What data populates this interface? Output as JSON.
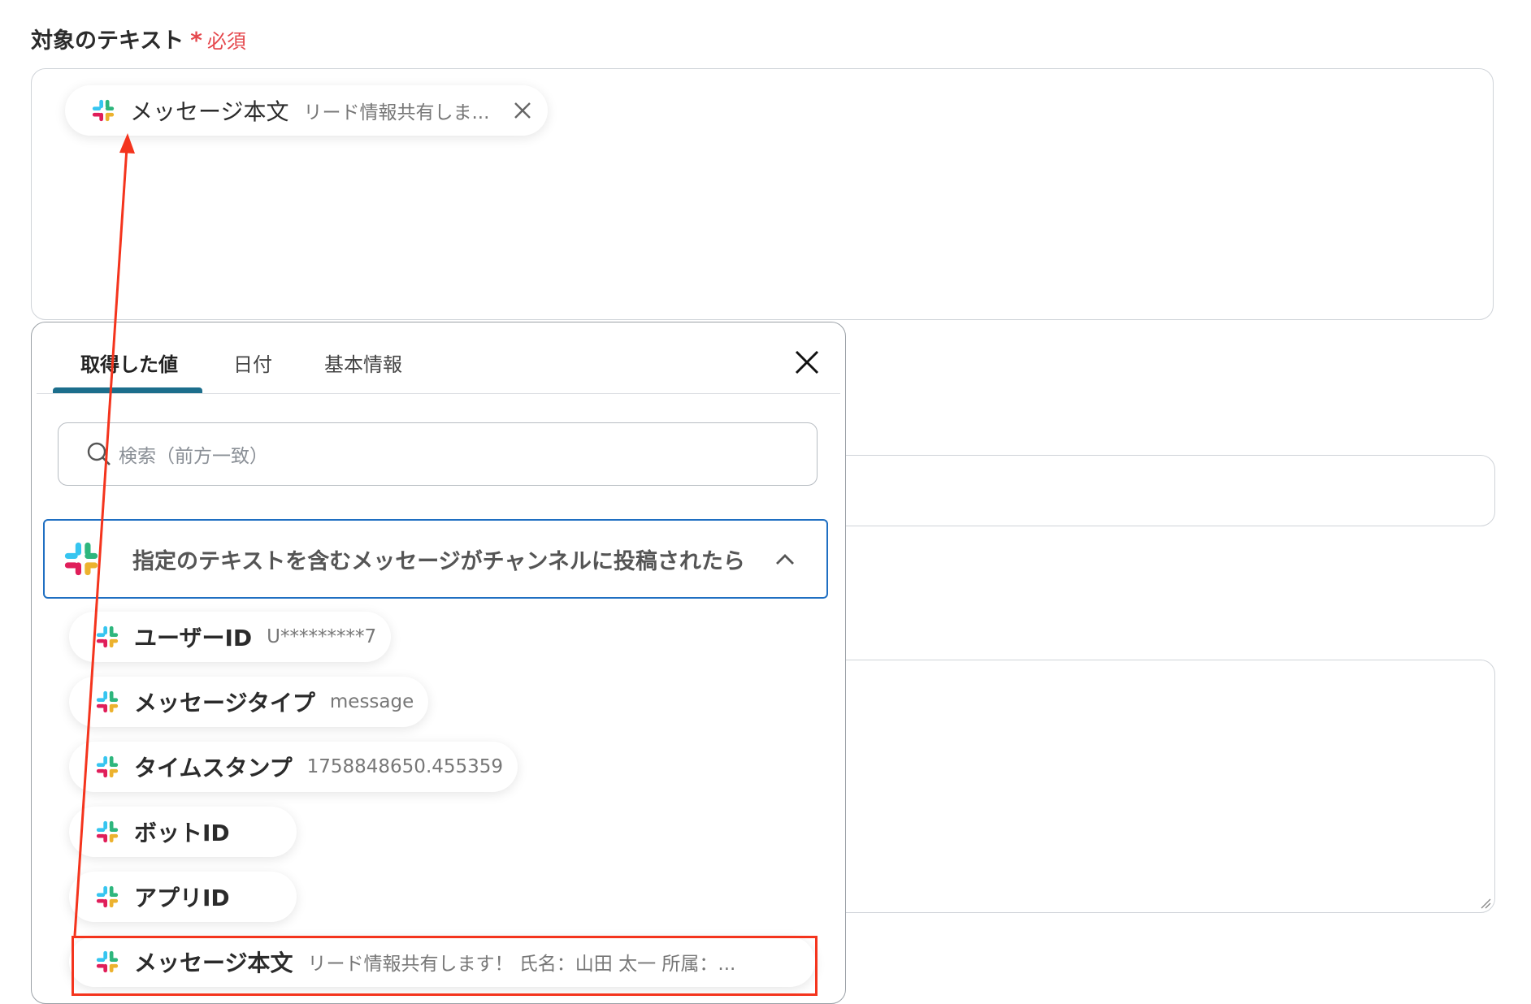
{
  "field": {
    "label": "対象のテキスト",
    "required_star": "*",
    "required_text": "必須"
  },
  "selected_chip": {
    "icon": "slack-icon",
    "name": "メッセージ本文",
    "value": "リード情報共有しま..."
  },
  "popup": {
    "tabs": [
      {
        "label": "取得した値",
        "active": true
      },
      {
        "label": "日付",
        "active": false
      },
      {
        "label": "基本情報",
        "active": false
      }
    ],
    "search": {
      "placeholder": "検索（前方一致）"
    },
    "group": {
      "title": "指定のテキストを含むメッセージがチャンネルに投稿されたら",
      "expanded": true
    },
    "items": [
      {
        "name": "ユーザーID",
        "value": "U*********7"
      },
      {
        "name": "メッセージタイプ",
        "value": "message"
      },
      {
        "name": "タイムスタンプ",
        "value": "1758848650.455359"
      },
      {
        "name": "ボットID",
        "value": ""
      },
      {
        "name": "アプリID",
        "value": ""
      },
      {
        "name": "メッセージ本文",
        "value": "リード情報共有します！ 氏名：山田 太一 所属：..."
      }
    ]
  },
  "colors": {
    "accent_tab": "#1c6e8c",
    "group_border": "#1f6fc2",
    "annotation_red": "#f4341d",
    "required_red": "#e5484d"
  }
}
